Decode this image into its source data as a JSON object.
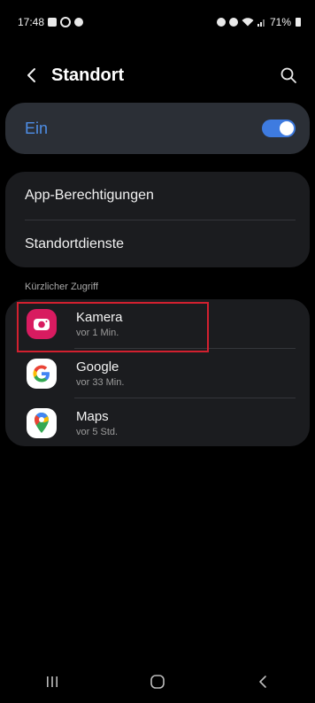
{
  "status_bar": {
    "time": "17:48",
    "battery": "71%"
  },
  "header": {
    "title": "Standort"
  },
  "master_switch": {
    "label": "Ein",
    "state": "on",
    "accent_color": "#3e7be0"
  },
  "settings": {
    "items": [
      {
        "label": "App-Berechtigungen"
      },
      {
        "label": "Standortdienste"
      }
    ]
  },
  "recent": {
    "section_label": "Kürzlicher Zugriff",
    "apps": [
      {
        "name": "Kamera",
        "time": "vor 1 Min.",
        "icon": "camera-icon",
        "highlighted": true
      },
      {
        "name": "Google",
        "time": "vor 33 Min.",
        "icon": "google-icon"
      },
      {
        "name": "Maps",
        "time": "vor 5 Std.",
        "icon": "maps-icon"
      }
    ]
  },
  "highlight_color": "#d2202f"
}
